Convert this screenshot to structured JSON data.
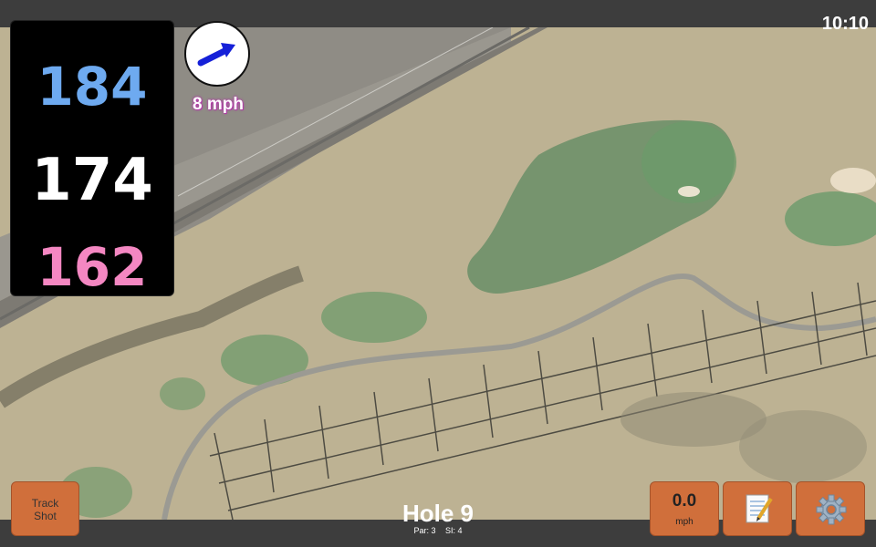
{
  "status": {
    "time": "10:10"
  },
  "distances": {
    "back": "184",
    "middle": "174",
    "front": "162"
  },
  "wind": {
    "speed": "8 mph",
    "icon": "wind-direction-arrow-icon"
  },
  "buttons": {
    "track_shot_line1": "Track",
    "track_shot_line2": "Shot",
    "speed_value": "0.0",
    "speed_unit": "mph",
    "notes_icon": "notepad-icon",
    "settings_icon": "gear-icon"
  },
  "hole": {
    "title": "Hole 9",
    "par": "Par: 3",
    "si": "SI: 4"
  },
  "colors": {
    "back": "#6eaaf0",
    "middle": "#ffffff",
    "front": "#f487c2",
    "button": "#d06f3b",
    "wind_text_glow": "#b23aa8"
  }
}
